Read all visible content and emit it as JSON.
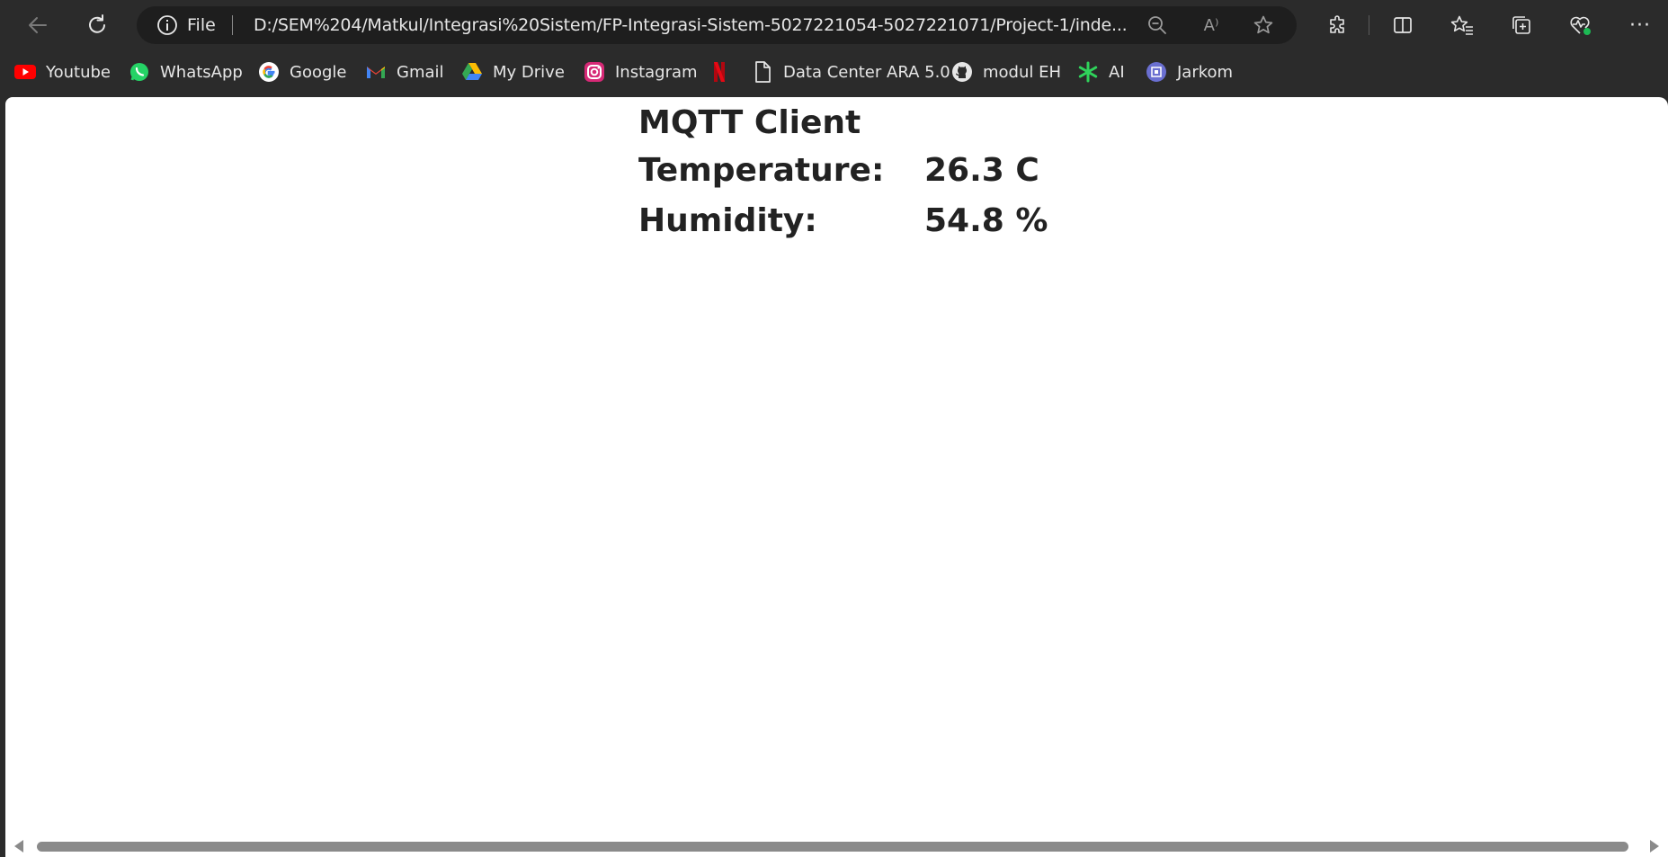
{
  "toolbar": {
    "back_icon": "back-arrow-icon",
    "refresh_icon": "refresh-icon",
    "site_info_label": "File",
    "url": "D:/SEM%204/Matkul/Integrasi%20Sistem/FP-Integrasi-Sistem-5027221054-5027221071/Project-1/inde...",
    "read_aloud_glyph": "A⁾",
    "more_glyph": "···"
  },
  "bookmarks": [
    {
      "label": "Youtube",
      "icon": "youtube-icon",
      "color": "#ff0000"
    },
    {
      "label": "WhatsApp",
      "icon": "whatsapp-icon",
      "color": "#25d366"
    },
    {
      "label": "Google",
      "icon": "google-icon",
      "color": "#4285f4"
    },
    {
      "label": "Gmail",
      "icon": "gmail-icon",
      "color": "#ea4335"
    },
    {
      "label": "My Drive",
      "icon": "google-drive-icon",
      "color": "#fbbc04"
    },
    {
      "label": "Instagram",
      "icon": "instagram-icon",
      "color": "#e1306c"
    },
    {
      "label": "",
      "icon": "netflix-icon",
      "color": "#e50914"
    },
    {
      "label": "Data Center ARA 5.0",
      "icon": "document-icon",
      "color": "#e6e6e6"
    },
    {
      "label": "modul EH",
      "icon": "github-icon",
      "color": "#e6e6e6"
    },
    {
      "label": "AI",
      "icon": "asterisk-icon",
      "color": "#2fd35b"
    },
    {
      "label": "Jarkom",
      "icon": "jarkom-icon",
      "color": "#6a6fd1"
    }
  ],
  "page": {
    "title": "MQTT Client",
    "temperature_label": "Temperature:",
    "temperature_value": "26.3 C",
    "humidity_label": "Humidity:",
    "humidity_value": "54.8 %"
  },
  "colors": {
    "chrome_bg": "#2b2b2b",
    "address_bg": "#1e1e1e",
    "page_bg": "#ffffff",
    "page_text": "#222222"
  }
}
